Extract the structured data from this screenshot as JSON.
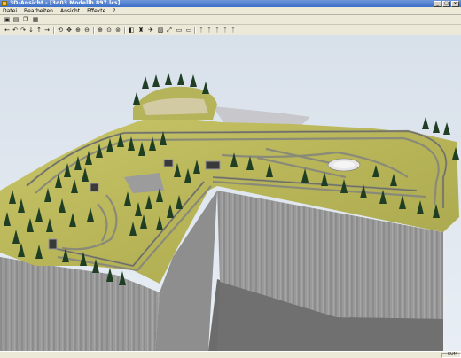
{
  "window": {
    "title": "3D-Ansicht - [3d03 Modellb 897.lcs]",
    "controls": {
      "minimize": "_",
      "maximize": "□",
      "close": "×"
    }
  },
  "menu": {
    "items": [
      "Datei",
      "Bearbeiten",
      "Ansicht",
      "Effekte",
      "?"
    ]
  },
  "toolbar1": {
    "buttons": [
      {
        "icon": "save-icon",
        "glyph": "▣"
      },
      {
        "icon": "print-icon",
        "glyph": "▤"
      },
      {
        "icon": "copy-icon",
        "glyph": "❐"
      },
      {
        "icon": "export-icon",
        "glyph": "▦"
      }
    ]
  },
  "toolbar2": {
    "buttons": [
      {
        "icon": "arrow-left-icon",
        "glyph": "←"
      },
      {
        "icon": "turn-left-icon",
        "glyph": "↶"
      },
      {
        "icon": "turn-right-icon",
        "glyph": "↷"
      },
      {
        "icon": "arrow-down-icon",
        "glyph": "↓"
      },
      {
        "icon": "arrow-up-icon",
        "glyph": "↑"
      },
      {
        "icon": "arrow-right-icon",
        "glyph": "→"
      },
      {
        "icon": "orbit-icon",
        "glyph": "⟲"
      },
      {
        "icon": "pan-icon",
        "glyph": "✥"
      },
      {
        "icon": "zoom-icon",
        "glyph": "⊕"
      },
      {
        "icon": "zoom-out-icon",
        "glyph": "⊖"
      },
      {
        "icon": "zoom-in-icon",
        "glyph": "⊕"
      },
      {
        "icon": "zoom-fit-icon",
        "glyph": "⊙"
      },
      {
        "icon": "zoom-all-icon",
        "glyph": "⊚"
      },
      {
        "icon": "camera-icon",
        "glyph": "◧"
      },
      {
        "icon": "walk-icon",
        "glyph": "♜"
      },
      {
        "icon": "fly-icon",
        "glyph": "✈"
      },
      {
        "icon": "scenery-icon",
        "glyph": "▨"
      },
      {
        "icon": "fullscreen-icon",
        "glyph": "⤢"
      },
      {
        "icon": "train1-icon",
        "glyph": "▭"
      },
      {
        "icon": "train2-icon",
        "glyph": "▭"
      },
      {
        "icon": "signal1-icon",
        "glyph": "ᛉ"
      },
      {
        "icon": "signal2-icon",
        "glyph": "ᛉ"
      },
      {
        "icon": "signal3-icon",
        "glyph": "ᛉ"
      },
      {
        "icon": "signal4-icon",
        "glyph": "ᛉ"
      },
      {
        "icon": "signal5-icon",
        "glyph": "ᛉ"
      }
    ]
  },
  "status": {
    "indicator": "SUM"
  }
}
